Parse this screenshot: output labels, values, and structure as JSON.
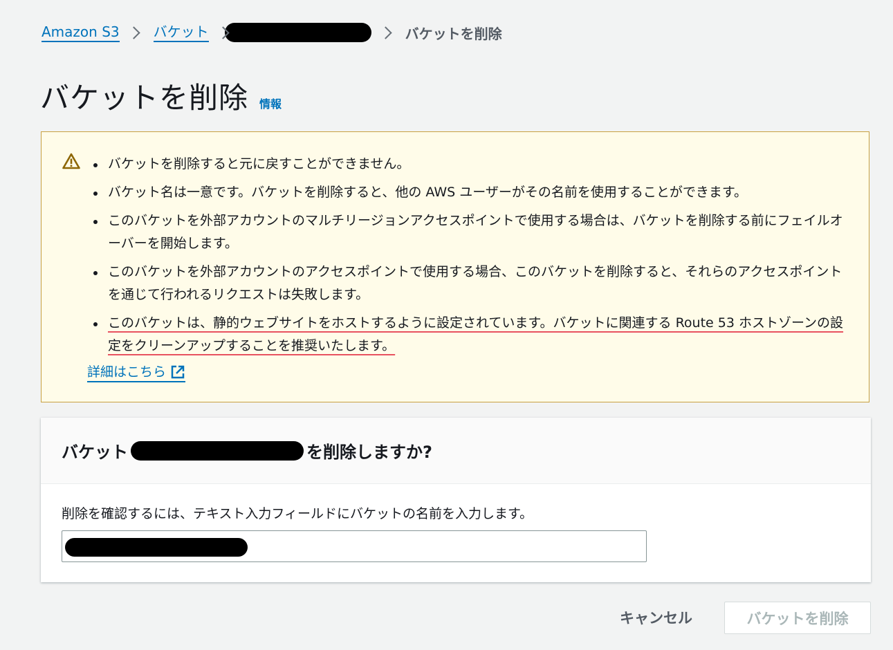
{
  "breadcrumb": {
    "root": "Amazon S3",
    "buckets": "バケット",
    "current": "バケットを削除"
  },
  "header": {
    "title": "バケットを削除",
    "info": "情報"
  },
  "warning": {
    "icon": "warning-triangle-icon",
    "items": [
      "バケットを削除すると元に戻すことができません。",
      "バケット名は一意です。バケットを削除すると、他の AWS ユーザーがその名前を使用することができます。",
      "このバケットを外部アカウントのマルチリージョンアクセスポイントで使用する場合は、バケットを削除する前にフェイルオーバーを開始します。",
      "このバケットを外部アカウントのアクセスポイントで使用する場合、このバケットを削除すると、それらのアクセスポイントを通じて行われるリクエストは失敗します。",
      "このバケットは、静的ウェブサイトをホストするように設定されています。バケットに関連する Route 53 ホストゾーンの設定をクリーンアップすることを推奨いたします。"
    ],
    "learn_more": "詳細はこちら"
  },
  "confirm": {
    "title_prefix": "バケット",
    "title_suffix": "を削除しますか?",
    "instruction": "削除を確認するには、テキスト入力フィールドにバケットの名前を入力します。"
  },
  "actions": {
    "cancel": "キャンセル",
    "delete": "バケットを削除"
  },
  "colors": {
    "link": "#0073bb",
    "warning_bg": "#fffce9",
    "warning_border": "#c7a040",
    "annotation_underline": "#e8525f"
  }
}
